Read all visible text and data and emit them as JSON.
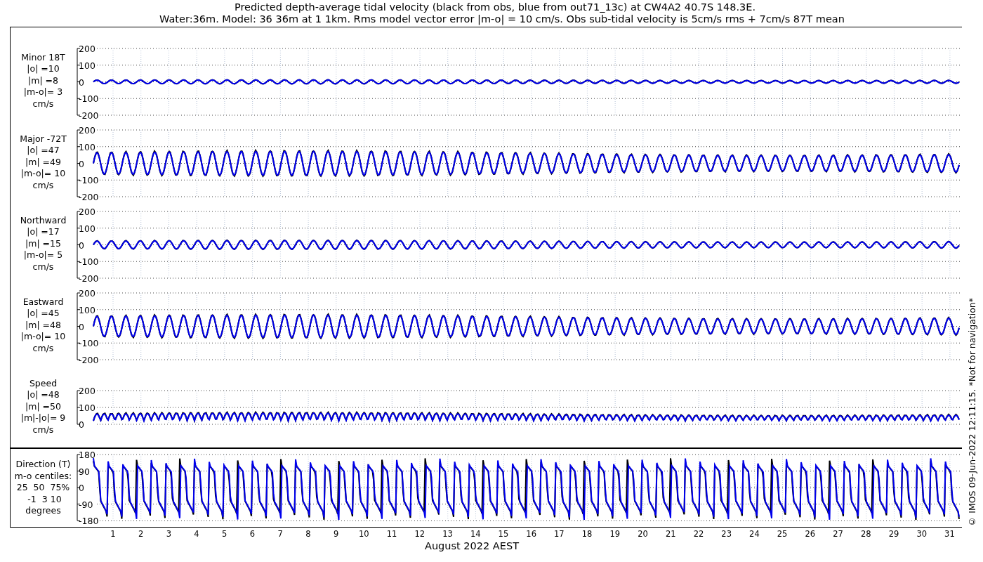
{
  "title": [
    "Predicted depth-average tidal velocity (black from obs, blue from out71_13c) at CW4A2 40.7S 148.3E.",
    "Water:36m. Model: 36 36m at 1 1km. Rms model vector error |m-o| = 10 cm/s. Obs sub-tidal velocity is 5cm/s rms + 7cm/s 87T mean"
  ],
  "panels": [
    {
      "kind": "minor",
      "lines": [
        "Minor 18T",
        "|o| =10",
        "|m| =8",
        "|m-o|= 3",
        "cm/s"
      ],
      "tick_labels": [
        "200",
        "100",
        "0",
        "-100",
        "-200"
      ]
    },
    {
      "kind": "major",
      "lines": [
        "Major -72T",
        "|o| =47",
        "|m| =49",
        "|m-o|= 10",
        "cm/s"
      ],
      "tick_labels": [
        "200",
        "100",
        "0",
        "-100",
        "-200"
      ]
    },
    {
      "kind": "north",
      "lines": [
        "Northward",
        "|o| =17",
        "|m| =15",
        "|m-o|= 5",
        "cm/s"
      ],
      "tick_labels": [
        "200",
        "100",
        "0",
        "-100",
        "-200"
      ]
    },
    {
      "kind": "east",
      "lines": [
        "Eastward",
        "|o| =45",
        "|m| =48",
        "|m-o|= 10",
        "cm/s"
      ],
      "tick_labels": [
        "200",
        "100",
        "0",
        "-100",
        "-200"
      ]
    },
    {
      "kind": "speed",
      "lines": [
        "Speed",
        "|o| =48",
        "|m| =50",
        "|m|-|o|= 9",
        "cm/s"
      ],
      "tick_labels": [
        "200",
        "100",
        "0"
      ]
    }
  ],
  "direction": {
    "kind": "direction",
    "lines": [
      "Direction (T)",
      "m-o centiles:",
      "25  50  75%",
      " -1  3 10",
      "degrees"
    ],
    "tick_labels": [
      "180",
      "90",
      "0",
      "-90",
      "-180"
    ]
  },
  "days": [
    "1",
    "2",
    "3",
    "4",
    "5",
    "6",
    "7",
    "8",
    "9",
    "10",
    "11",
    "12",
    "13",
    "14",
    "15",
    "16",
    "17",
    "18",
    "19",
    "20",
    "21",
    "22",
    "23",
    "24",
    "25",
    "26",
    "27",
    "28",
    "29",
    "30",
    "31"
  ],
  "xlabel": "August 2022 AEST",
  "footer": "© IMOS 09-Jun-2022 12:11:15. *Not for navigation*"
}
